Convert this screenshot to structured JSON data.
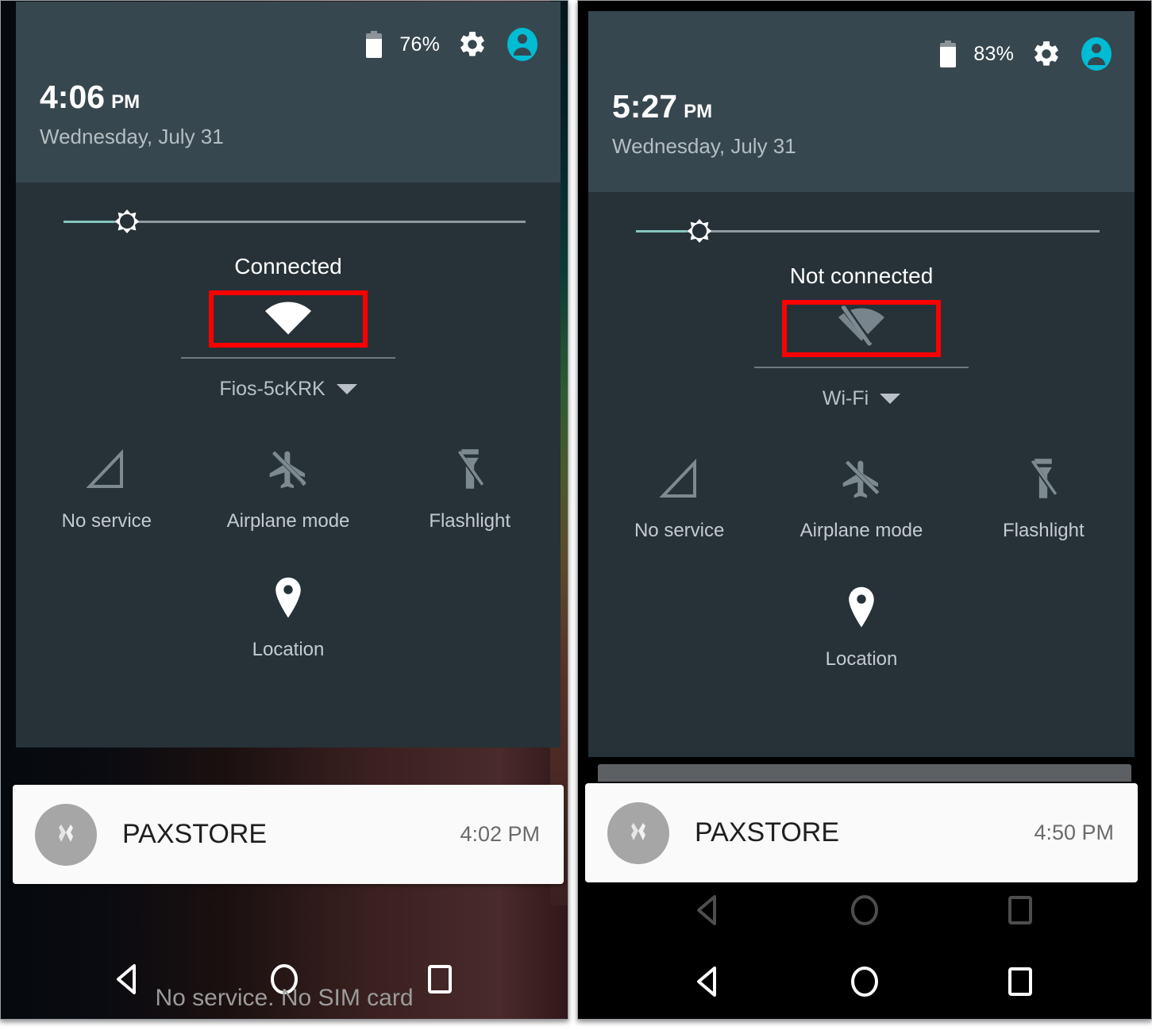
{
  "panels": [
    {
      "id": "left",
      "status": {
        "battery_percent": "76%",
        "battery_level": 76
      },
      "clock": {
        "time": "4:06",
        "ampm": "PM",
        "date": "Wednesday, July 31"
      },
      "brightness": {
        "level": 11
      },
      "wifi": {
        "state_label": "Connected",
        "ssid_label": "Fios-5cKRK",
        "icon": "wifi-full-icon",
        "highlight_color": "#fc0000"
      },
      "tiles": [
        {
          "label": "No service",
          "icon": "signal-no-service-icon"
        },
        {
          "label": "Airplane mode",
          "icon": "airplane-off-icon"
        },
        {
          "label": "Flashlight",
          "icon": "flashlight-off-icon"
        }
      ],
      "tile_single": {
        "label": "Location",
        "icon": "location-pin-icon"
      },
      "notification": {
        "app": "PAXSTORE",
        "time": "4:02 PM",
        "icon": "paxstore-icon"
      },
      "overlay_text": "No service.   No SIM card",
      "navbar": [
        {
          "icon": "back-triangle-icon"
        },
        {
          "icon": "home-circle-icon"
        },
        {
          "icon": "recents-square-icon"
        }
      ]
    },
    {
      "id": "right",
      "status": {
        "battery_percent": "83%",
        "battery_level": 83
      },
      "clock": {
        "time": "5:27",
        "ampm": "PM",
        "date": "Wednesday, July 31"
      },
      "brightness": {
        "level": 11
      },
      "wifi": {
        "state_label": "Not connected",
        "ssid_label": "Wi-Fi",
        "icon": "wifi-off-icon",
        "highlight_color": "#fc0000"
      },
      "tiles": [
        {
          "label": "No service",
          "icon": "signal-no-service-icon"
        },
        {
          "label": "Airplane mode",
          "icon": "airplane-off-icon"
        },
        {
          "label": "Flashlight",
          "icon": "flashlight-off-icon"
        }
      ],
      "tile_single": {
        "label": "Location",
        "icon": "location-pin-icon"
      },
      "notification": {
        "app": "PAXSTORE",
        "time": "4:50 PM",
        "icon": "paxstore-icon"
      },
      "overlay_text": "",
      "navbar": [
        {
          "icon": "back-triangle-icon"
        },
        {
          "icon": "home-circle-icon"
        },
        {
          "icon": "recents-square-icon"
        }
      ]
    }
  ],
  "colors": {
    "shade_bg": "#263238",
    "header_bg": "#37474f",
    "accent_teal": "#00bcd4",
    "highlight_red": "#fc0000",
    "slider_fill": "#84c6bd"
  }
}
